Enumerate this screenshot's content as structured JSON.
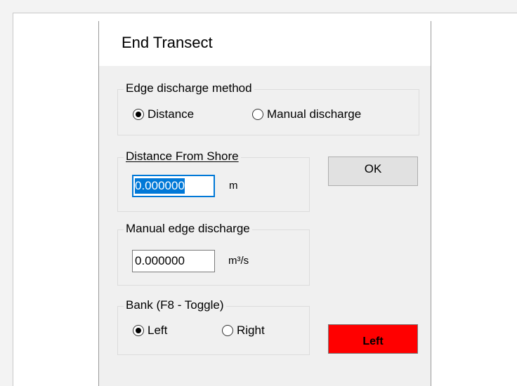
{
  "dialog": {
    "title": "End Transect",
    "edge_method": {
      "label": "Edge discharge method",
      "options": [
        "Distance",
        "Manual discharge"
      ],
      "selected": "Distance"
    },
    "distance": {
      "label": "Distance From Shore",
      "value": "0.000000",
      "unit": "m"
    },
    "manual": {
      "label": "Manual edge discharge",
      "value": "0.000000",
      "unit": "m³/s"
    },
    "bank": {
      "label": "Bank (F8 - Toggle)",
      "options": [
        "Left",
        "Right"
      ],
      "selected": "Left"
    },
    "ok_label": "OK",
    "bank_button_label": "Left"
  },
  "colors": {
    "dialog_bg": "#f0f0f0",
    "focus": "#0078d7",
    "bank_button": "#ff0000"
  },
  "icons": {
    "radio_selected": "radio-selected-icon",
    "radio_unselected": "radio-unselected-icon"
  }
}
